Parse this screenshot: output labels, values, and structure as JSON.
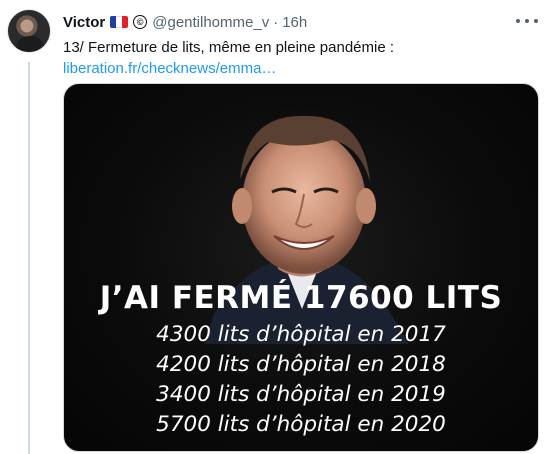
{
  "tweet": {
    "author_name": "Victor",
    "handle": "@gentilhomme_v",
    "separator": "·",
    "time": "16h",
    "text": "13/ Fermeture de lits, même en pleine pandémie :",
    "link": "liberation.fr/checknews/emma…",
    "icons": {
      "flag": "france-flag-icon",
      "copyright": "copyright-icon",
      "more": "more-options-icon"
    }
  },
  "media": {
    "headline": "J’AI FERMÉ 17600 LITS",
    "lines": [
      "4300 lits d’hôpital en 2017",
      "4200 lits d’hôpital en 2018",
      "3400 lits d’hôpital en 2019",
      "5700 lits d’hôpital en 2020"
    ]
  }
}
